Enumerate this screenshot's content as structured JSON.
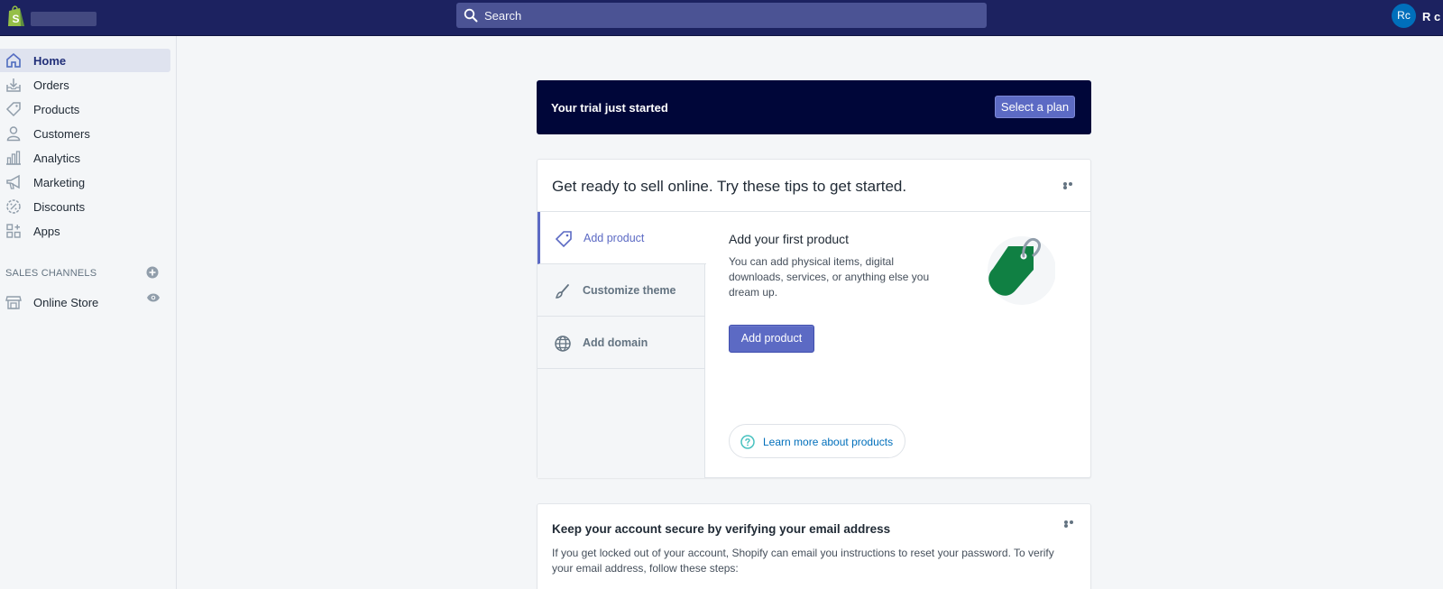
{
  "topbar": {
    "search_placeholder": "Search",
    "avatar_initials": "Rc",
    "user_name": "R c",
    "colors": {
      "background": "#1c2260",
      "search": "#4b5394",
      "avatar": "#006fbb"
    }
  },
  "sidebar": {
    "items": [
      {
        "label": "Home",
        "icon": "home-icon"
      },
      {
        "label": "Orders",
        "icon": "orders-icon"
      },
      {
        "label": "Products",
        "icon": "tag-icon"
      },
      {
        "label": "Customers",
        "icon": "person-icon"
      },
      {
        "label": "Analytics",
        "icon": "bar-chart-icon"
      },
      {
        "label": "Marketing",
        "icon": "megaphone-icon"
      },
      {
        "label": "Discounts",
        "icon": "discount-icon"
      },
      {
        "label": "Apps",
        "icon": "apps-icon"
      }
    ],
    "sales_channels_title": "SALES CHANNELS",
    "online_store_label": "Online Store"
  },
  "trial": {
    "text": "Your trial just started",
    "button_label": "Select a plan",
    "color": "#000639"
  },
  "tips": {
    "title": "Get ready to sell online. Try these tips to get started.",
    "tabs": [
      {
        "label": "Add product",
        "icon": "tag-icon"
      },
      {
        "label": "Customize theme",
        "icon": "brush-icon"
      },
      {
        "label": "Add domain",
        "icon": "globe-icon"
      }
    ],
    "panel_title": "Add your first product",
    "panel_description": "You can add physical items, digital downloads, services, or anything else you dream up.",
    "panel_button": "Add product",
    "learn_more": "Learn more about products",
    "accent_color": "#5c6ac4"
  },
  "secure": {
    "title": "Keep your account secure by verifying your email address",
    "description": "If you get locked out of your account, Shopify can email you instructions to reset your password. To verify your email address, follow these steps:"
  }
}
